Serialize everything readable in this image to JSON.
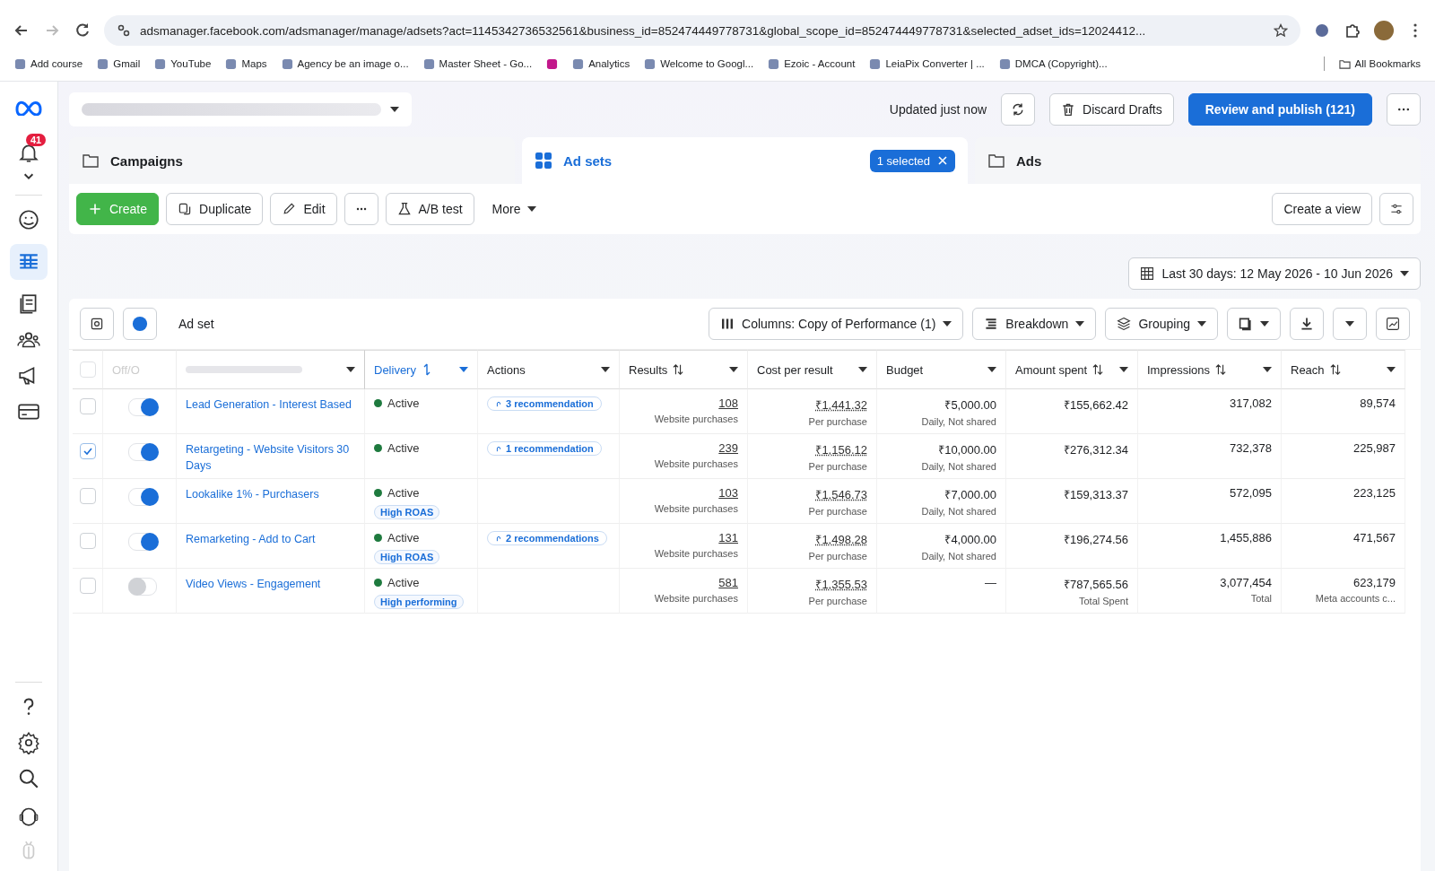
{
  "browser": {
    "url": "adsmanager.facebook.com/adsmanager/manage/adsets?act=1145342736532561&business_id=852474449778731&global_scope_id=852474449778731&selected_adset_ids=12024412...",
    "bookmarks": [
      {
        "kind": "link",
        "label": "Add course"
      },
      {
        "kind": "link",
        "label": "Gmail"
      },
      {
        "kind": "link",
        "label": "YouTube"
      },
      {
        "kind": "link",
        "label": "Maps"
      },
      {
        "kind": "link",
        "label": "Agency be an image o..."
      },
      {
        "kind": "link",
        "label": "Master Sheet - Go..."
      },
      {
        "kind": "icon"
      },
      {
        "kind": "link",
        "label": "Analytics"
      },
      {
        "kind": "link",
        "label": "Welcome to Googl..."
      },
      {
        "kind": "link",
        "label": "Ezoic - Account"
      },
      {
        "kind": "link",
        "label": "LeiaPix Converter | ..."
      },
      {
        "kind": "link",
        "label": "DMCA (Copyright)..."
      }
    ],
    "all_bookmarks": "All Bookmarks"
  },
  "sidebar": {
    "notification_count": "41"
  },
  "header": {
    "status": "Updated just now",
    "discard": "Discard Drafts",
    "publish": "Review and publish (121)"
  },
  "tabs": [
    {
      "label": "Campaigns",
      "selected": false
    },
    {
      "label": "Ad sets",
      "selected": true,
      "badge": "1 selected"
    },
    {
      "label": "Ads",
      "selected": false
    }
  ],
  "toolbar": {
    "buttons": [
      "Create",
      "Duplicate",
      "Edit",
      "A/B test"
    ],
    "more": "More",
    "create_view": "Create a view"
  },
  "date_range": "Last 30 days: 12 May 2026 - 10 Jun 2026",
  "table_toolbar": {
    "title": "Ad set",
    "columns": "Columns: Copy of Performance (1)",
    "breakdown": "Breakdown",
    "grouping": "Grouping"
  },
  "table": {
    "select_all": {
      "checked": false
    },
    "columns": [
      {
        "label": "Off/O",
        "sorted": false
      },
      {
        "sorted": false
      },
      {
        "label": "Delivery",
        "sorted": true
      },
      {
        "label": "Actions",
        "sorted": false
      },
      {
        "label": "Results",
        "sorted": false
      },
      {
        "label": "Cost per result",
        "sorted": false
      },
      {
        "label": "Budget",
        "sorted": false
      },
      {
        "label": "Amount spent",
        "sorted": false
      },
      {
        "label": "Impressions",
        "sorted": false
      },
      {
        "label": "Reach",
        "sorted": false
      }
    ],
    "rows": [
      {
        "checked": false,
        "on": true,
        "name": "Lead Generation - Interest Based",
        "delivery": "Active",
        "recommendation": "3 recommendation",
        "results": "108",
        "results_sub": "Website purchases",
        "cost": "₹1,441.32",
        "cost_sub": "Per purchase",
        "budget": "₹5,000.00",
        "budget_sub": "Daily, Not shared",
        "spent": "₹155,662.42",
        "impressions": "317,082",
        "reach": "89,574"
      },
      {
        "checked": true,
        "on": true,
        "name": "Retargeting - Website Visitors 30 Days",
        "delivery": "Active",
        "recommendation": "1 recommendation",
        "results": "239",
        "results_sub": "Website purchases",
        "cost": "₹1,156.12",
        "cost_sub": "Per purchase",
        "budget": "₹10,000.00",
        "budget_sub": "Daily, Not shared",
        "spent": "₹276,312.34",
        "impressions": "732,378",
        "reach": "225,987"
      },
      {
        "checked": false,
        "on": true,
        "name": "Lookalike 1% - Purchasers",
        "delivery": "Active",
        "tag": "High ROAS",
        "results": "103",
        "results_sub": "Website purchases",
        "cost": "₹1,546.73",
        "cost_sub": "Per purchase",
        "budget": "₹7,000.00",
        "budget_sub": "Daily, Not shared",
        "spent": "₹159,313.37",
        "impressions": "572,095",
        "reach": "223,125"
      },
      {
        "checked": false,
        "on": true,
        "name": "Remarketing - Add to Cart",
        "delivery": "Active",
        "tag": "High ROAS",
        "recommendation": "2 recommendations",
        "results": "131",
        "results_sub": "Website purchases",
        "cost": "₹1,498.28",
        "cost_sub": "Per purchase",
        "budget": "₹4,000.00",
        "budget_sub": "Daily, Not shared",
        "spent": "₹196,274.56",
        "impressions": "1,455,886",
        "reach": "471,567"
      },
      {
        "checked": false,
        "on": false,
        "name": "Video Views - Engagement",
        "delivery": "Active",
        "tag": "High performing",
        "results": "581",
        "results_sub": "Website purchases",
        "cost": "₹1,355.53",
        "cost_sub": "Per purchase",
        "budget": "—",
        "spent": "₹787,565.56",
        "spent_sub": "Total Spent",
        "impressions": "3,077,454",
        "impressions_sub": "Total",
        "reach": "623,179",
        "reach_sub": "Meta accounts c..."
      }
    ]
  }
}
